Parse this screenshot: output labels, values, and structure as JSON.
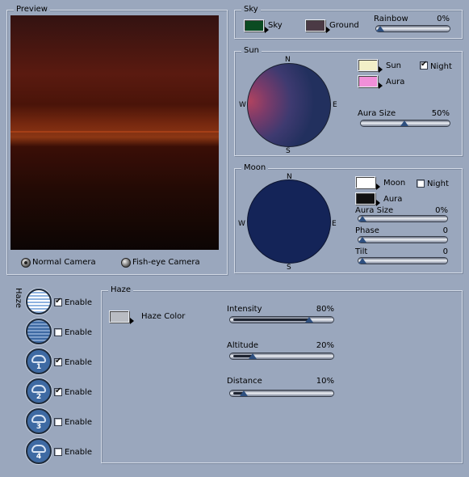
{
  "preview": {
    "legend": "Preview"
  },
  "camera": {
    "normal_label": "Normal Camera",
    "fisheye_label": "Fish-eye Camera",
    "selected": "normal"
  },
  "sky": {
    "legend": "Sky",
    "sky_label": "Sky",
    "sky_color": "#0b4b22",
    "ground_label": "Ground",
    "ground_color": "#4b3a45",
    "rainbow_label": "Rainbow",
    "rainbow_value": "0%",
    "rainbow_level": 0.0
  },
  "sun": {
    "legend": "Sun",
    "compass": {
      "n": "N",
      "s": "S",
      "e": "E",
      "w": "W"
    },
    "sun_label": "Sun",
    "sun_color": "#f2efc8",
    "aura_label": "Aura",
    "aura_color": "#f08fd8",
    "night_label": "Night",
    "night_checked": true,
    "aura_size_label": "Aura Size",
    "aura_size_value": "50%",
    "aura_size_level": 0.5
  },
  "moon": {
    "legend": "Moon",
    "compass": {
      "n": "N",
      "s": "S",
      "e": "E",
      "w": "W"
    },
    "moon_label": "Moon",
    "moon_color": "#ffffff",
    "aura_label": "Aura",
    "aura_color": "#111111",
    "night_label": "Night",
    "night_checked": false,
    "aura_size_label": "Aura Size",
    "aura_size_value": "0%",
    "aura_size_level": 0.0,
    "phase_label": "Phase",
    "phase_value": "0",
    "phase_level": 0.0,
    "tilt_label": "Tilt",
    "tilt_value": "0",
    "tilt_level": 0.0
  },
  "haze_side_label": "Haze",
  "haze_layers": [
    {
      "enable_label": "Enable",
      "checked": true
    },
    {
      "enable_label": "Enable",
      "checked": false
    },
    {
      "enable_label": "Enable",
      "checked": true,
      "number": "1"
    },
    {
      "enable_label": "Enable",
      "checked": true,
      "number": "2"
    },
    {
      "enable_label": "Enable",
      "checked": false,
      "number": "3"
    },
    {
      "enable_label": "Enable",
      "checked": false,
      "number": "4"
    }
  ],
  "haze": {
    "legend": "Haze",
    "color_label": "Haze Color",
    "color": "#b9bcc2",
    "intensity_label": "Intensity",
    "intensity_value": "80%",
    "intensity_level": 0.8,
    "altitude_label": "Altitude",
    "altitude_value": "20%",
    "altitude_level": 0.2,
    "distance_label": "Distance",
    "distance_value": "10%",
    "distance_level": 0.1
  }
}
